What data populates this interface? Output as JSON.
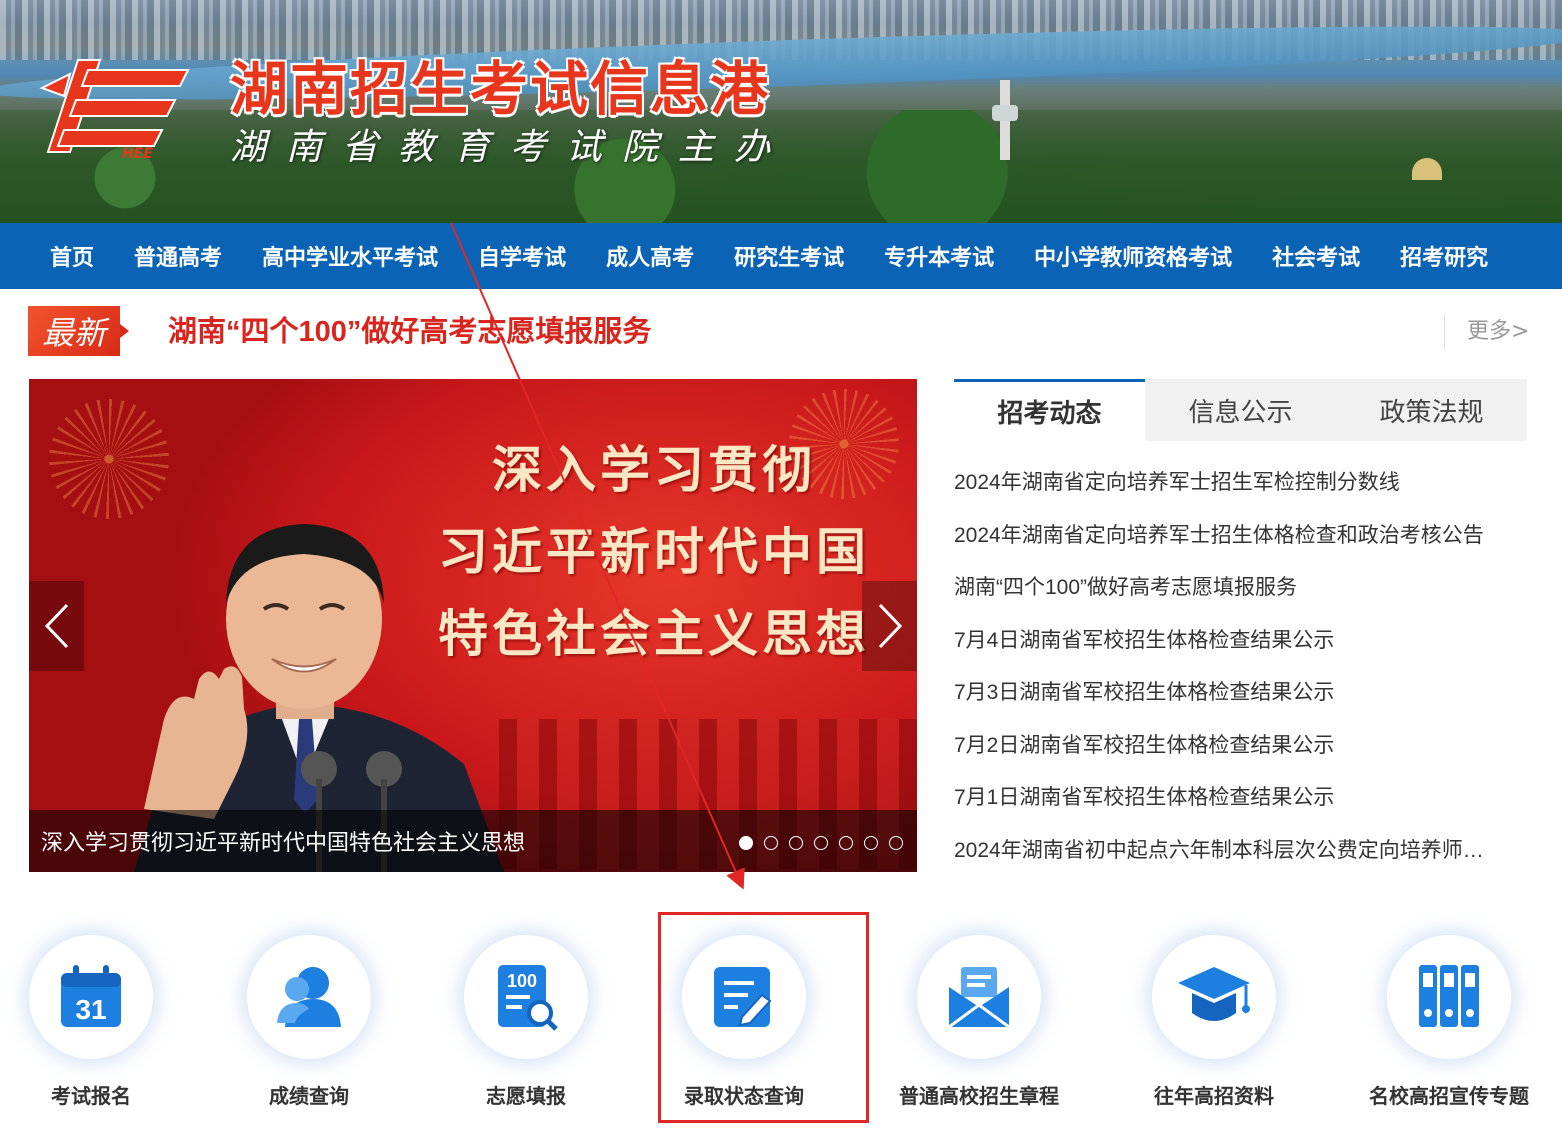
{
  "header": {
    "site_title": "湖南招生考试信息港",
    "site_subtitle": "湖南省教育考试院主办",
    "logo_text": "HEE"
  },
  "nav": {
    "items": [
      "首页",
      "普通高考",
      "高中学业水平考试",
      "自学考试",
      "成人高考",
      "研究生考试",
      "专升本考试",
      "中小学教师资格考试",
      "社会考试",
      "招考研究"
    ]
  },
  "latest": {
    "badge": "最新",
    "headline": "湖南“四个100”做好高考志愿填报服务",
    "more": "更多>"
  },
  "slider": {
    "slogan_lines": [
      "深入学习贯彻",
      "习近平新时代中国",
      "特色社会主义思想"
    ],
    "caption": "深入学习贯彻习近平新时代中国特色社会主义思想",
    "dot_count": 7,
    "active_dot": 0
  },
  "news": {
    "tabs": [
      "招考动态",
      "信息公示",
      "政策法规"
    ],
    "active_tab": 0,
    "items": [
      "2024年湖南省定向培养军士招生军检控制分数线",
      "2024年湖南省定向培养军士招生体格检查和政治考核公告",
      "湖南“四个100”做好高考志愿填报服务",
      "7月4日湖南省军校招生体格检查结果公示",
      "7月3日湖南省军校招生体格检查结果公示",
      "7月2日湖南省军校招生体格检查结果公示",
      "7月1日湖南省军校招生体格检查结果公示",
      "2024年湖南省初中起点六年制本科层次公费定向培养师…"
    ]
  },
  "services": [
    {
      "label": "考试报名",
      "icon": "calendar-icon",
      "icon_text": "31"
    },
    {
      "label": "成绩查询",
      "icon": "user-icon"
    },
    {
      "label": "志愿填报",
      "icon": "score-search-icon",
      "icon_text": "100"
    },
    {
      "label": "录取状态查询",
      "icon": "edit-document-icon"
    },
    {
      "label": "普通高校招生章程",
      "icon": "envelope-icon"
    },
    {
      "label": "往年高招资料",
      "icon": "graduation-cap-icon"
    },
    {
      "label": "名校高招宣传专题",
      "icon": "binders-icon"
    }
  ],
  "colors": {
    "nav_bg": "#0b63b6",
    "accent_red": "#d8251d",
    "icon_blue": "#1d7fe0"
  }
}
